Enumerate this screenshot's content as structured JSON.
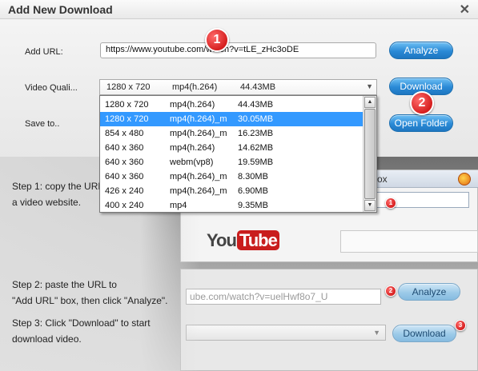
{
  "window": {
    "title": "Add New Download",
    "close_icon": "close-icon"
  },
  "form": {
    "add_url_label": "Add URL:",
    "url_value": "https://www.youtube.com/watch?v=tLE_zHc3oDE",
    "video_quality_label": "Video Quali...",
    "save_to_label": "Save to..",
    "analyze_label": "Analyze",
    "download_label": "Download",
    "open_folder_label": "Open Folder",
    "selected": {
      "resolution": "1280 x 720",
      "format": "mp4(h.264)",
      "size": "44.43MB"
    }
  },
  "quality_options": [
    {
      "resolution": "1280 x 720",
      "format": "mp4(h.264)",
      "size": "44.43MB",
      "selected": false
    },
    {
      "resolution": "1280 x 720",
      "format": "mp4(h.264)_m",
      "size": "30.05MB",
      "selected": true
    },
    {
      "resolution": "854 x 480",
      "format": "mp4(h.264)_m",
      "size": "16.23MB",
      "selected": false
    },
    {
      "resolution": "640 x 360",
      "format": "mp4(h.264)",
      "size": "14.62MB",
      "selected": false
    },
    {
      "resolution": "640 x 360",
      "format": "webm(vp8)",
      "size": "19.59MB",
      "selected": false
    },
    {
      "resolution": "640 x 360",
      "format": "mp4(h.264)_m",
      "size": "8.30MB",
      "selected": false
    },
    {
      "resolution": "426 x 240",
      "format": "mp4(h.264)_m",
      "size": "6.90MB",
      "selected": false
    },
    {
      "resolution": "400 x 240",
      "format": "mp4",
      "size": "9.35MB",
      "selected": false
    }
  ],
  "annotations": {
    "badge1": "1",
    "badge2": "2",
    "help_badge1": "1",
    "help_badge2": "2",
    "help_badge3": "3"
  },
  "help": {
    "step1_line1": "Step 1: copy the URL",
    "step1_line2": "a video website.",
    "step2_line1": "Step 2: paste the URL to",
    "step2_line2": "\"Add URL\" box, then click \"Analyze\".",
    "step3_line1": "Step 3: Click \"Download\" to start",
    "step3_line2": "download video.",
    "browser_box_text": "ox",
    "youtube_logo_you": "You",
    "youtube_logo_tube": "Tube",
    "demo_url": "ube.com/watch?v=uelHwf8o7_U",
    "demo_analyze_label": "Analyze",
    "demo_download_label": "Download"
  },
  "colors": {
    "accent": "#2a8ad6",
    "selection": "#3399ff",
    "badge": "#c40000"
  }
}
